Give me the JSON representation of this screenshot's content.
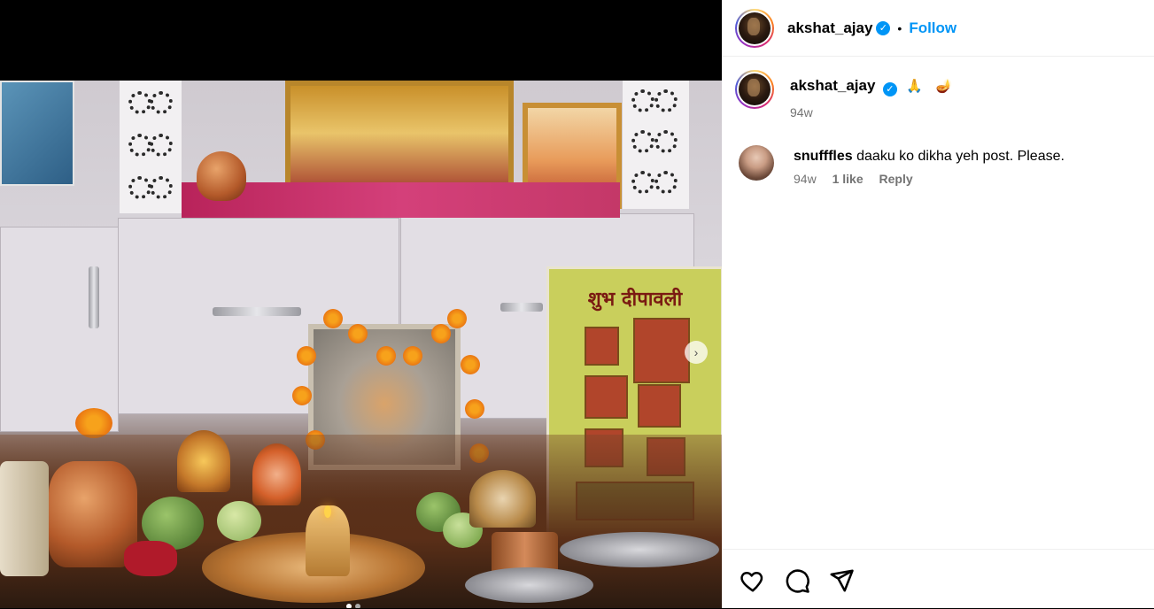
{
  "header": {
    "username": "akshat_ajay",
    "verified": true,
    "separator": "•",
    "follow_label": "Follow"
  },
  "caption": {
    "username": "akshat_ajay",
    "verified": true,
    "emojis": [
      "🙏",
      "🪔"
    ],
    "time": "94w"
  },
  "comments": [
    {
      "username": "snufffles",
      "text": "daaku ko dikha yeh post. Please.",
      "time": "94w",
      "likes": "1 like",
      "reply_label": "Reply"
    }
  ],
  "media": {
    "poster_text": "शुभ दीपावली",
    "carousel_dots": 2,
    "active_dot": 0
  },
  "icons": [
    "heart-icon",
    "comment-icon",
    "share-icon",
    "verified-icon",
    "next-arrow-icon"
  ],
  "colors": {
    "accent": "#0095f6",
    "muted": "#737373",
    "border": "#efefef"
  }
}
